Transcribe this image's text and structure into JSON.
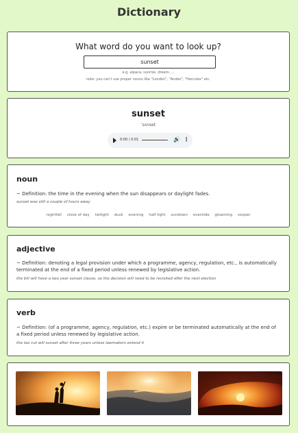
{
  "app": {
    "title": "Dictionary"
  },
  "search": {
    "prompt": "What word do you want to look up?",
    "value": "sunset",
    "hint": "e.g. alpaca, sunrise, dream, ...",
    "note": "note: you can't use proper nouns like \"London\", \"Andes\", \"Hercules\" etc."
  },
  "word": {
    "text": "sunset",
    "phonetic": "ˈsʌnset",
    "audio": {
      "time": "0:00 / 0:01"
    }
  },
  "entries": [
    {
      "pos": "noun",
      "definition": "~ Definition: the time in the evening when the sun disappears or daylight fades.",
      "example": "sunset was still a couple of hours away",
      "synonyms": [
        "nightfall",
        "close of day",
        "twilight",
        "dusk",
        "evening",
        "half light",
        "sundown",
        "eventide",
        "gloaming",
        "vesper"
      ]
    },
    {
      "pos": "adjective",
      "definition": "~ Definition: denoting a legal provision under which a programme, agency, regulation, etc., is automatically terminated at the end of a fixed period unless renewed by legislative action.",
      "example": "the bill will have a two year sunset clause, so the decision will need to be revisited after the next election"
    },
    {
      "pos": "verb",
      "definition": "~ Definition: (of a programme, agency, regulation, etc.) expire or be terminated automatically at the end of a fixed period unless renewed by legislative action.",
      "example": "the tax cut will sunset after three years unless lawmakers extend it"
    }
  ],
  "images": [
    {
      "name": "silhouette-sunset-image"
    },
    {
      "name": "ocean-sunset-image"
    },
    {
      "name": "wave-sunset-image"
    }
  ]
}
